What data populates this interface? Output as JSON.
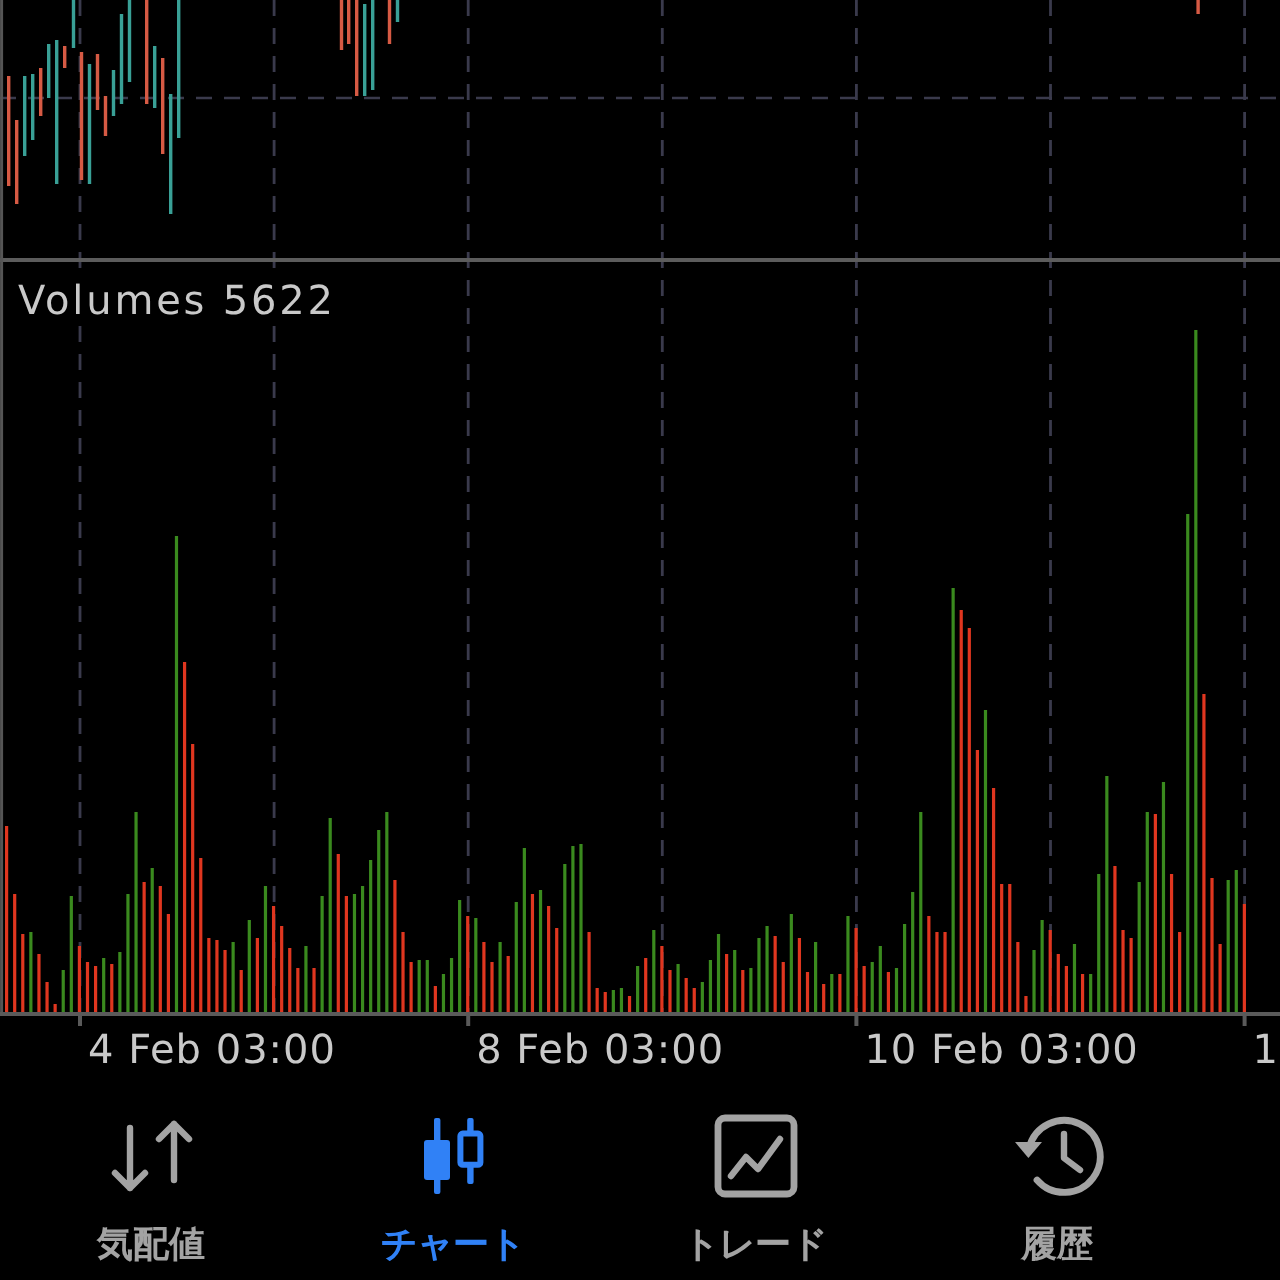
{
  "volume_panel": {
    "title": "Volumes 5622"
  },
  "time_axis": {
    "labels": [
      "4 Feb 03:00",
      "8 Feb 03:00",
      "10 Feb 03:00",
      "1"
    ]
  },
  "tab_bar": {
    "tabs": [
      {
        "label": "気配値",
        "selected": false
      },
      {
        "label": "チャート",
        "selected": true
      },
      {
        "label": "トレード",
        "selected": false
      },
      {
        "label": "履歴",
        "selected": false
      }
    ]
  }
}
